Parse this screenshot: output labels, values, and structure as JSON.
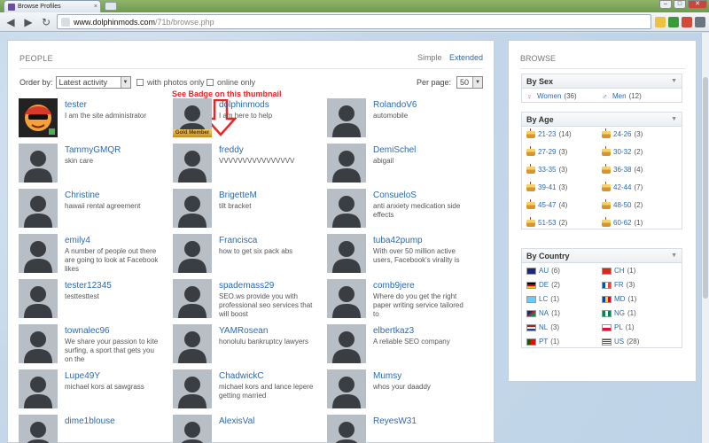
{
  "browser": {
    "tab_title": "Browse Profiles",
    "url_host": "www.dolphinmods.com",
    "url_path": "/71b/browse.php",
    "tab_close": "×",
    "win_min": "–",
    "win_max": "□",
    "win_close": "✕",
    "back": "◀",
    "forward": "▶",
    "reload": "↻"
  },
  "people": {
    "title": "PEOPLE",
    "view_simple": "Simple",
    "view_extended": "Extended",
    "order_label": "Order by:",
    "order_value": "Latest activity",
    "with_photos": "with photos only",
    "online_only": "online only",
    "perpage_label": "Per page:",
    "perpage_value": "50",
    "annotation": "See Badge on this thumbnail",
    "badge_label": "Gold Member",
    "profiles": [
      {
        "name": "tester",
        "desc": "I am the site administrator"
      },
      {
        "name": "dolphinmods",
        "desc": "I am here to help"
      },
      {
        "name": "RolandoV6",
        "desc": "automobile"
      },
      {
        "name": "TammyGMQR",
        "desc": "skin care"
      },
      {
        "name": "freddy",
        "desc": "VVVVVVVVVVVVVVVV"
      },
      {
        "name": "DemiSchel",
        "desc": "abigail"
      },
      {
        "name": "Christine",
        "desc": "hawaii rental agreement"
      },
      {
        "name": "BrigetteM",
        "desc": "tilt bracket"
      },
      {
        "name": "ConsueloS",
        "desc": "anti anxiety medication side effects"
      },
      {
        "name": "emily4",
        "desc": "A number of people out there are going to look at Facebook likes"
      },
      {
        "name": "Francisca",
        "desc": "how to get six pack abs"
      },
      {
        "name": "tuba42pump",
        "desc": "With over 50 million active users, Facebook's virality is"
      },
      {
        "name": "tester12345",
        "desc": "testtesttest"
      },
      {
        "name": "spademass29",
        "desc": "SEO.ws provide you with professional seo services that will boost"
      },
      {
        "name": "comb9jere",
        "desc": "Where do you get the right paper writing service tailored to"
      },
      {
        "name": "townalec96",
        "desc": "We share your passion to kite surfing, a sport that gets you on the"
      },
      {
        "name": "YAMRosean",
        "desc": "honolulu bankruptcy lawyers"
      },
      {
        "name": "elbertkaz3",
        "desc": "A reliable SEO company"
      },
      {
        "name": "Lupe49Y",
        "desc": "michael kors at sawgrass"
      },
      {
        "name": "ChadwickC",
        "desc": "michael kors and lance lepere getting married"
      },
      {
        "name": "Mumsy",
        "desc": "whos your daaddy"
      },
      {
        "name": "dime1blouse",
        "desc": ""
      },
      {
        "name": "AlexisVal",
        "desc": ""
      },
      {
        "name": "ReyesW31",
        "desc": ""
      }
    ]
  },
  "browse": {
    "title": "BROWSE",
    "sex": {
      "heading": "By Sex",
      "items": [
        {
          "label": "Women",
          "count": "(36)"
        },
        {
          "label": "Men",
          "count": "(12)"
        }
      ]
    },
    "age": {
      "heading": "By Age",
      "items": [
        {
          "label": "21-23",
          "count": "(14)"
        },
        {
          "label": "24-26",
          "count": "(3)"
        },
        {
          "label": "27-29",
          "count": "(3)"
        },
        {
          "label": "30-32",
          "count": "(2)"
        },
        {
          "label": "33-35",
          "count": "(3)"
        },
        {
          "label": "36-38",
          "count": "(4)"
        },
        {
          "label": "39-41",
          "count": "(3)"
        },
        {
          "label": "42-44",
          "count": "(7)"
        },
        {
          "label": "45-47",
          "count": "(4)"
        },
        {
          "label": "48-50",
          "count": "(2)"
        },
        {
          "label": "51-53",
          "count": "(2)"
        },
        {
          "label": "60-62",
          "count": "(1)"
        }
      ]
    },
    "country": {
      "heading": "By Country",
      "items": [
        {
          "label": "AU",
          "count": "(6)"
        },
        {
          "label": "CH",
          "count": "(1)"
        },
        {
          "label": "DE",
          "count": "(2)"
        },
        {
          "label": "FR",
          "count": "(3)"
        },
        {
          "label": "LC",
          "count": "(1)"
        },
        {
          "label": "MD",
          "count": "(1)"
        },
        {
          "label": "NA",
          "count": "(1)"
        },
        {
          "label": "NG",
          "count": "(1)"
        },
        {
          "label": "NL",
          "count": "(3)"
        },
        {
          "label": "PL",
          "count": "(1)"
        },
        {
          "label": "PT",
          "count": "(1)"
        },
        {
          "label": "US",
          "count": "(28)"
        }
      ]
    }
  }
}
